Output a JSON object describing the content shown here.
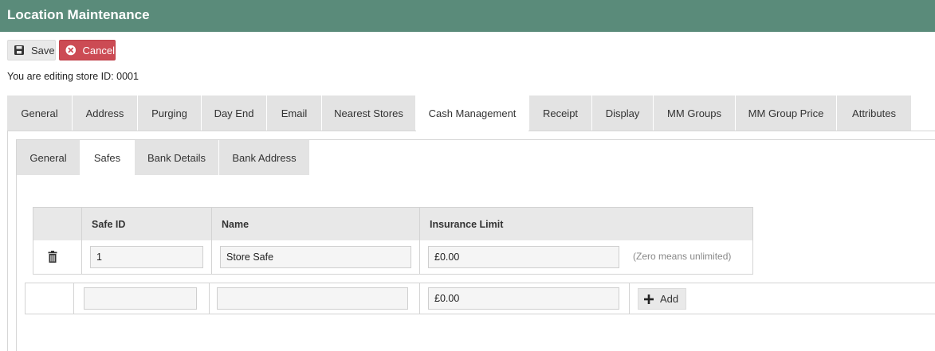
{
  "header": {
    "title": "Location Maintenance"
  },
  "toolbar": {
    "save_label": "Save",
    "cancel_label": "Cancel"
  },
  "editing_text": "You are editing store ID: 0001",
  "main_tabs": [
    {
      "label": "General"
    },
    {
      "label": "Address"
    },
    {
      "label": "Purging"
    },
    {
      "label": "Day End"
    },
    {
      "label": "Email"
    },
    {
      "label": "Nearest Stores"
    },
    {
      "label": "Cash Management",
      "active": true
    },
    {
      "label": "Receipt"
    },
    {
      "label": "Display"
    },
    {
      "label": "MM Groups"
    },
    {
      "label": "MM Group Price"
    },
    {
      "label": "Attributes"
    }
  ],
  "sub_tabs": [
    {
      "label": "General"
    },
    {
      "label": "Safes",
      "active": true
    },
    {
      "label": "Bank Details"
    },
    {
      "label": "Bank Address"
    }
  ],
  "safes_table": {
    "columns": [
      "Safe ID",
      "Name",
      "Insurance Limit"
    ],
    "rows": [
      {
        "safe_id": "1",
        "name": "Store Safe",
        "insurance_limit": "£0.00",
        "hint": "(Zero means unlimited)"
      }
    ]
  },
  "new_row": {
    "safe_id": "",
    "name": "",
    "insurance_limit": "£0.00",
    "add_label": "Add"
  },
  "colors": {
    "header_bg": "#5a8b7a",
    "cancel_bg": "#cc4b54",
    "tab_bg": "#e3e3e3"
  },
  "icons": {
    "save": "floppy-disk-icon",
    "cancel": "circle-x-icon",
    "delete": "trash-icon",
    "add": "plus-icon"
  }
}
